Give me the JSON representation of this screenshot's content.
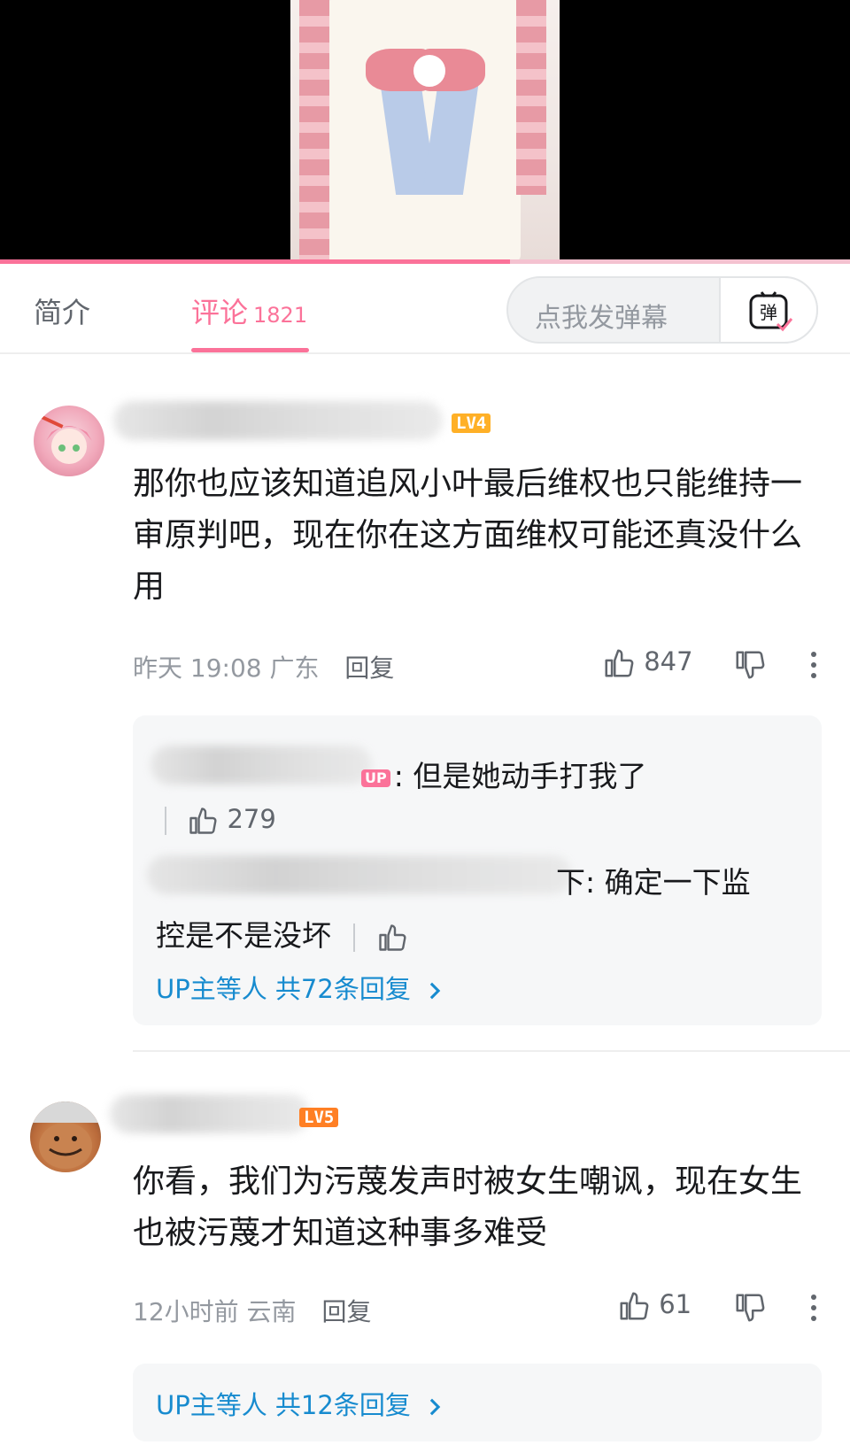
{
  "video": {
    "progress_fraction": 0.6
  },
  "tabs": {
    "intro_label": "简介",
    "comments_label": "评论",
    "comments_count": "1821",
    "danmaku_placeholder": "点我发弹幕",
    "danmaku_icon_text": "弹"
  },
  "comments": [
    {
      "level": "LV4",
      "text": "那你也应该知道追风小叶最后维权也只能维持一审原判吧，现在你在这方面维权可能还真没什么用",
      "time": "昨天 19:08",
      "location": "广东",
      "reply_label": "回复",
      "likes": "847",
      "replies": [
        {
          "up_badge": "UP",
          "text": ": 但是她动手打我了",
          "likes": "279"
        },
        {
          "text_tail": "下: 确定一下监",
          "text_line2": "控是不是没坏"
        }
      ],
      "more_replies": "UP主等人 共72条回复"
    },
    {
      "level": "LV5",
      "text": "你看，我们为污蔑发声时被女生嘲讽，现在女生也被污蔑才知道这种事多难受",
      "time": "12小时前",
      "location": "云南",
      "reply_label": "回复",
      "likes": "61",
      "more_replies": "UP主等人 共12条回复"
    }
  ],
  "colors": {
    "accent": "#fb7299",
    "link": "#178bcf",
    "muted": "#9499a0"
  }
}
